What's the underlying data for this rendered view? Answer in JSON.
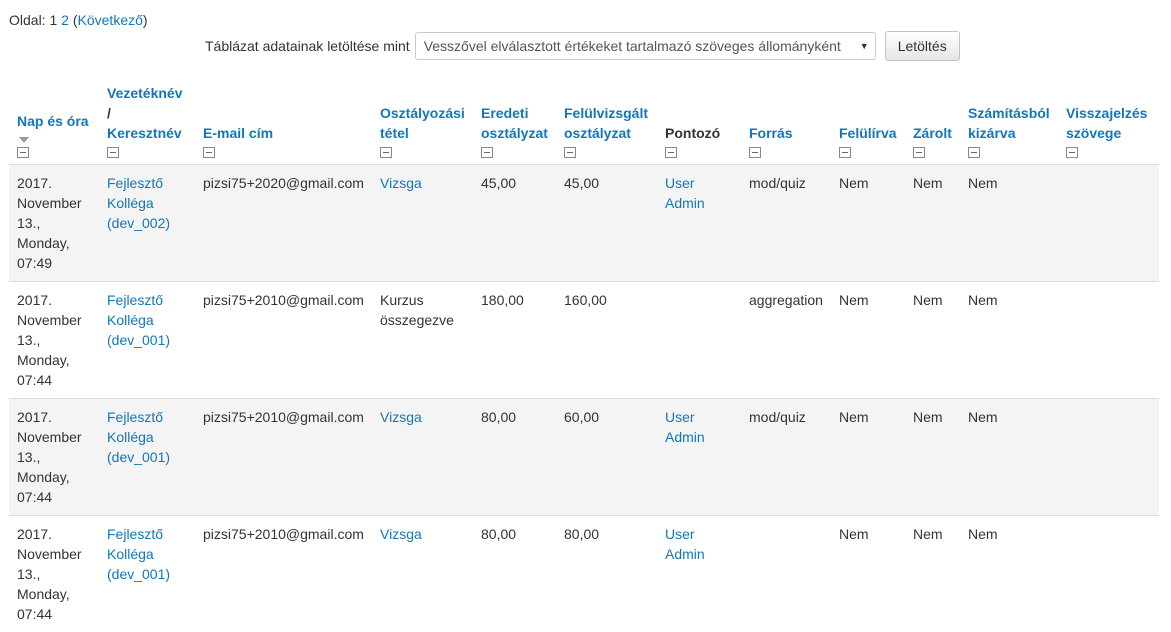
{
  "paging": {
    "label": "Oldal:",
    "pages": [
      "1",
      "2"
    ],
    "next_label": "Következő"
  },
  "download": {
    "label": "Táblázat adatainak letöltése mint",
    "selected_format": "Vesszővel elválasztott értékeket tartalmazó szöveges állományként",
    "button_label": "Letöltés"
  },
  "table": {
    "headers": {
      "date": "Nap és óra",
      "lastname": "Vezetéknév",
      "slash": "/",
      "firstname": "Keresztnév",
      "email": "E-mail cím",
      "item_1": "Osztályozási",
      "item_2": "tétel",
      "orig_1": "Eredeti",
      "orig_2": "osztályzat",
      "rev_1": "Felülvizsgált",
      "rev_2": "osztályzat",
      "grader": "Pontozó",
      "source": "Forrás",
      "overridden": "Felülírva",
      "locked": "Zárolt",
      "excl_1": "Számításból",
      "excl_2": "kizárva",
      "fb_1": "Visszajelzés",
      "fb_2": "szövege"
    },
    "rows": [
      {
        "date": [
          "2017.",
          "November",
          "13.,",
          "Monday,",
          "07:49"
        ],
        "name": [
          "Fejlesztő",
          "Kolléga",
          "(dev_002)"
        ],
        "email": "pizsi75+2020@gmail.com",
        "item": [
          "Vizsga"
        ],
        "item_is_link": true,
        "original": "45,00",
        "revised": "45,00",
        "grader": [
          "User",
          "Admin"
        ],
        "source": "mod/quiz",
        "overridden": "Nem",
        "locked": "Nem",
        "excluded": "Nem",
        "feedback": ""
      },
      {
        "date": [
          "2017.",
          "November",
          "13.,",
          "Monday,",
          "07:44"
        ],
        "name": [
          "Fejlesztő",
          "Kolléga",
          "(dev_001)"
        ],
        "email": "pizsi75+2010@gmail.com",
        "item": [
          "Kurzus",
          "összegezve"
        ],
        "item_is_link": false,
        "original": "180,00",
        "revised": "160,00",
        "grader": [
          "",
          ""
        ],
        "source": "aggregation",
        "overridden": "Nem",
        "locked": "Nem",
        "excluded": "Nem",
        "feedback": ""
      },
      {
        "date": [
          "2017.",
          "November",
          "13.,",
          "Monday,",
          "07:44"
        ],
        "name": [
          "Fejlesztő",
          "Kolléga",
          "(dev_001)"
        ],
        "email": "pizsi75+2010@gmail.com",
        "item": [
          "Vizsga"
        ],
        "item_is_link": true,
        "original": "80,00",
        "revised": "60,00",
        "grader": [
          "User",
          "Admin"
        ],
        "source": "mod/quiz",
        "overridden": "Nem",
        "locked": "Nem",
        "excluded": "Nem",
        "feedback": ""
      },
      {
        "date": [
          "2017.",
          "November",
          "13.,",
          "Monday,",
          "07:44"
        ],
        "name": [
          "Fejlesztő",
          "Kolléga",
          "(dev_001)"
        ],
        "email": "pizsi75+2010@gmail.com",
        "item": [
          "Vizsga"
        ],
        "item_is_link": true,
        "original": "80,00",
        "revised": "80,00",
        "grader": [
          "User",
          "Admin"
        ],
        "source": "",
        "overridden": "Nem",
        "locked": "Nem",
        "excluded": "Nem",
        "feedback": ""
      }
    ]
  },
  "colors": {
    "link": "#1177b8",
    "text": "#333333",
    "row_stripe": "#f4f4f4",
    "border": "#dddddd"
  }
}
